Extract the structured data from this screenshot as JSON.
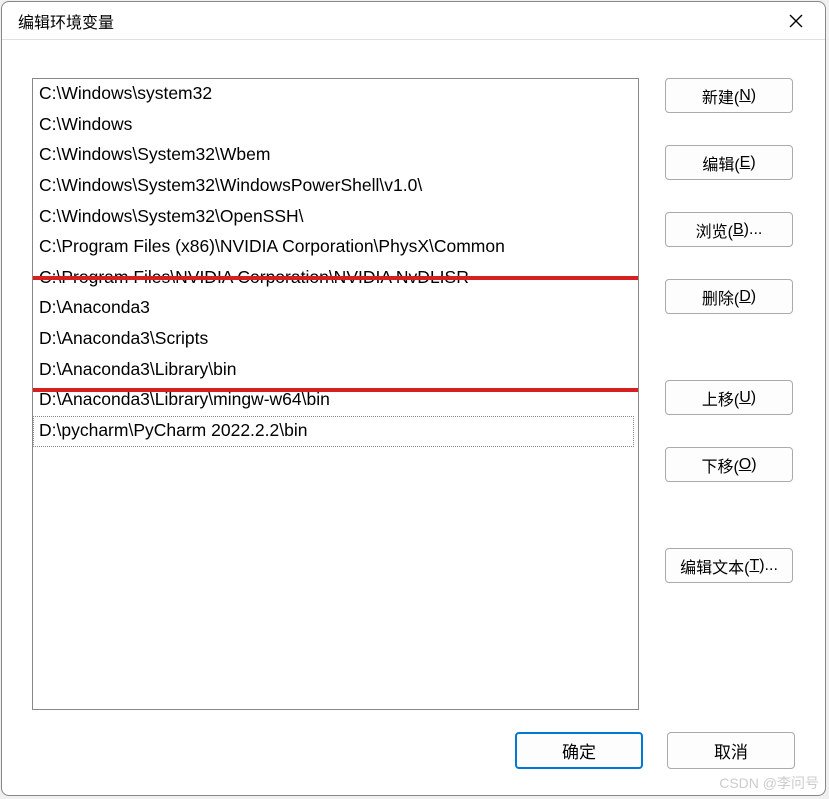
{
  "window": {
    "title": "编辑环境变量"
  },
  "list": {
    "items": [
      "C:\\Windows\\system32",
      "C:\\Windows",
      "C:\\Windows\\System32\\Wbem",
      "C:\\Windows\\System32\\WindowsPowerShell\\v1.0\\",
      "C:\\Windows\\System32\\OpenSSH\\",
      "C:\\Program Files (x86)\\NVIDIA Corporation\\PhysX\\Common",
      "C:\\Program Files\\NVIDIA Corporation\\NVIDIA NvDLISR",
      "D:\\Anaconda3",
      "D:\\Anaconda3\\Scripts",
      "D:\\Anaconda3\\Library\\bin",
      "D:\\Anaconda3\\Library\\mingw-w64\\bin",
      "D:\\pycharm\\PyCharm 2022.2.2\\bin"
    ],
    "selected_index": 11
  },
  "buttons": {
    "new": "新建(",
    "new_key": "N",
    "edit": "编辑(",
    "edit_key": "E",
    "browse": "浏览(",
    "browse_key": "B",
    "browse_suffix": ")...",
    "delete": "删除(",
    "delete_key": "D",
    "moveup": "上移(",
    "moveup_key": "U",
    "movedown": "下移(",
    "movedown_key": "O",
    "edittext": "编辑文本(",
    "edittext_key": "T",
    "edittext_suffix": ")...",
    "close_paren": ")"
  },
  "footer": {
    "ok": "确定",
    "cancel": "取消"
  },
  "watermark": "CSDN @李问号"
}
